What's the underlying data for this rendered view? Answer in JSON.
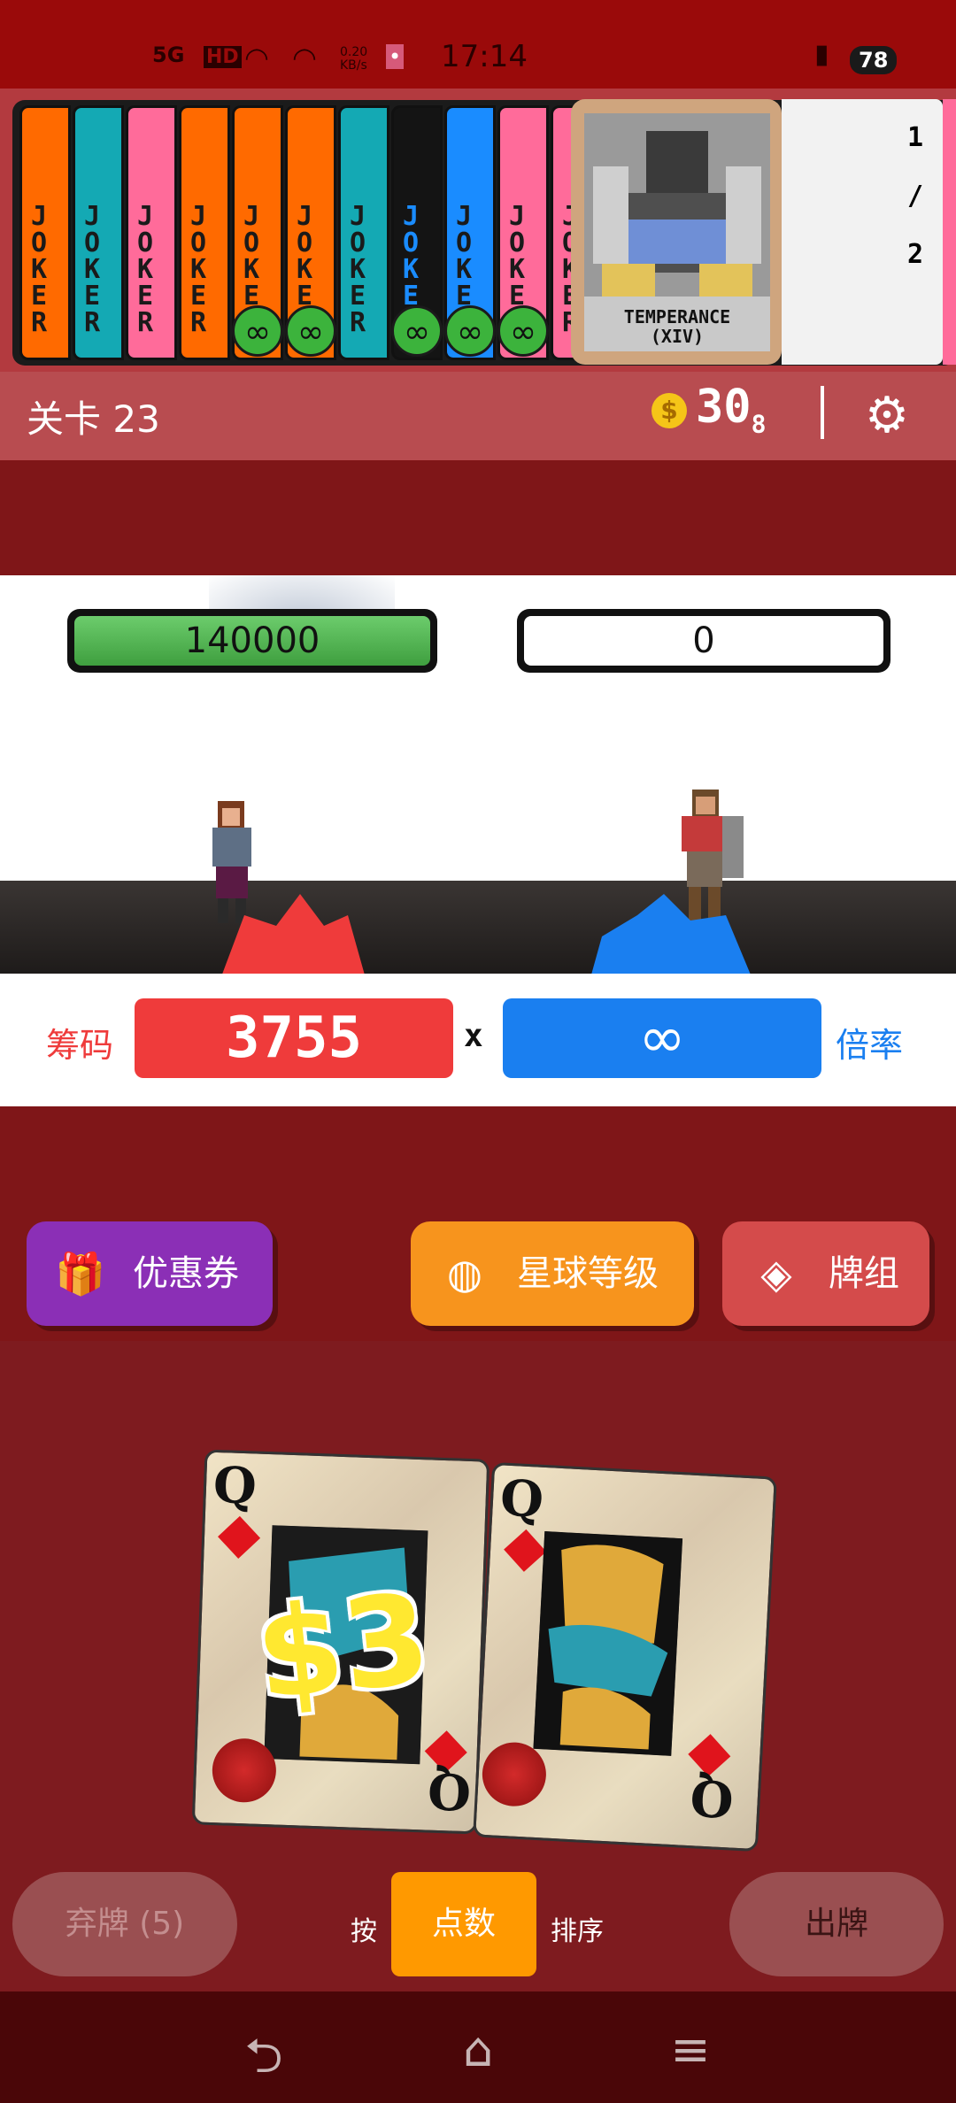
{
  "status_bar": {
    "network": "5G",
    "hd": "HD",
    "speed": "0.20 KB/s",
    "time": "17:14",
    "battery": "78"
  },
  "jokers": {
    "card_text": "JOKER",
    "infinity_symbol": "∞",
    "colors": [
      "#ff6a00",
      "#14a9b4",
      "#ff6b9a",
      "#ff6a00",
      "#ff6a00",
      "#ff6a00",
      "#14a9b4",
      "#141414",
      "#1a8cff",
      "#ff6b9a",
      "#ff6b9a"
    ],
    "infinity_count": 5,
    "featured": {
      "name": "TEMPERANCE",
      "numeral": "(XIV)",
      "side_top": "1",
      "side_mid": "/",
      "side_bottom": "2"
    }
  },
  "header": {
    "level": "关卡 23",
    "coin_symbol": "$",
    "money": "30",
    "money_sub": "8"
  },
  "battle": {
    "player_hp": "140000",
    "enemy_hp": "0",
    "chips_label": "筹码",
    "chips_value": "3755",
    "times_symbol": "x",
    "mult_value": "∞",
    "mult_label": "倍率",
    "player_hp_fill": 1.0,
    "enemy_hp_fill": 0.0
  },
  "actions": {
    "voucher_label": "优惠券",
    "planet_label": "星球等级",
    "deck_label": "牌组"
  },
  "hand": {
    "cards": [
      {
        "rank": "Q",
        "suit": "diamond"
      },
      {
        "rank": "Q",
        "suit": "diamond"
      }
    ],
    "bonus": "$3"
  },
  "controls": {
    "discard_label": "弃牌 (5)",
    "sort_prefix": "按",
    "sort_mode": "点数",
    "sort_suffix": "排序",
    "play_label": "出牌"
  },
  "nav": {
    "back_icon": "back-icon",
    "home_icon": "home-icon",
    "menu_icon": "menu-icon"
  }
}
